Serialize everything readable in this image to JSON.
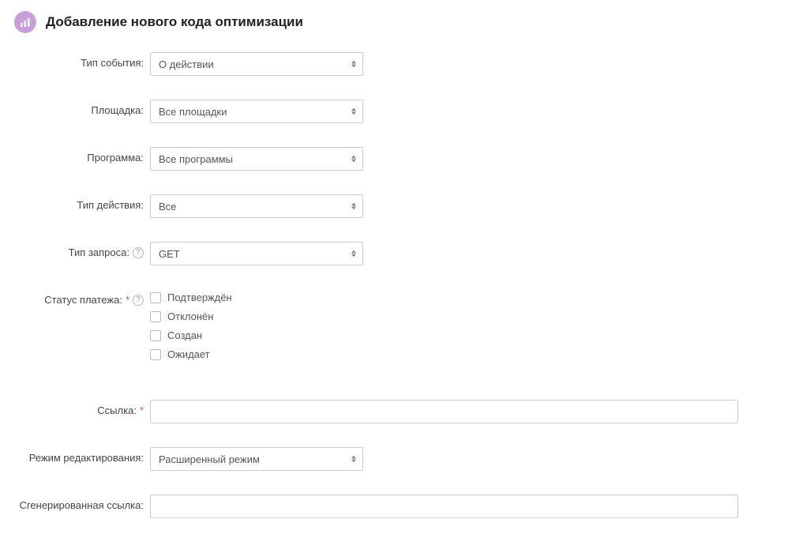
{
  "page": {
    "title": "Добавление нового кода оптимизации"
  },
  "form": {
    "event_type": {
      "label": "Тип события:",
      "value": "О действии"
    },
    "platform": {
      "label": "Площадка:",
      "value": "Все площадки"
    },
    "program": {
      "label": "Программа:",
      "value": "Все программы"
    },
    "action_type": {
      "label": "Тип действия:",
      "value": "Все"
    },
    "request_type": {
      "label": "Тип запроса:",
      "value": "GET"
    },
    "payment_status": {
      "label": "Статус платежа:",
      "options": {
        "confirmed": "Подтверждён",
        "declined": "Отклонён",
        "created": "Создан",
        "pending": "Ожидает"
      }
    },
    "link": {
      "label": "Ссылка:",
      "value": ""
    },
    "edit_mode": {
      "label": "Режим редактирования:",
      "value": "Расширенный режим"
    },
    "generated_link": {
      "label": "Сгенерированная ссылка:",
      "value": ""
    }
  }
}
